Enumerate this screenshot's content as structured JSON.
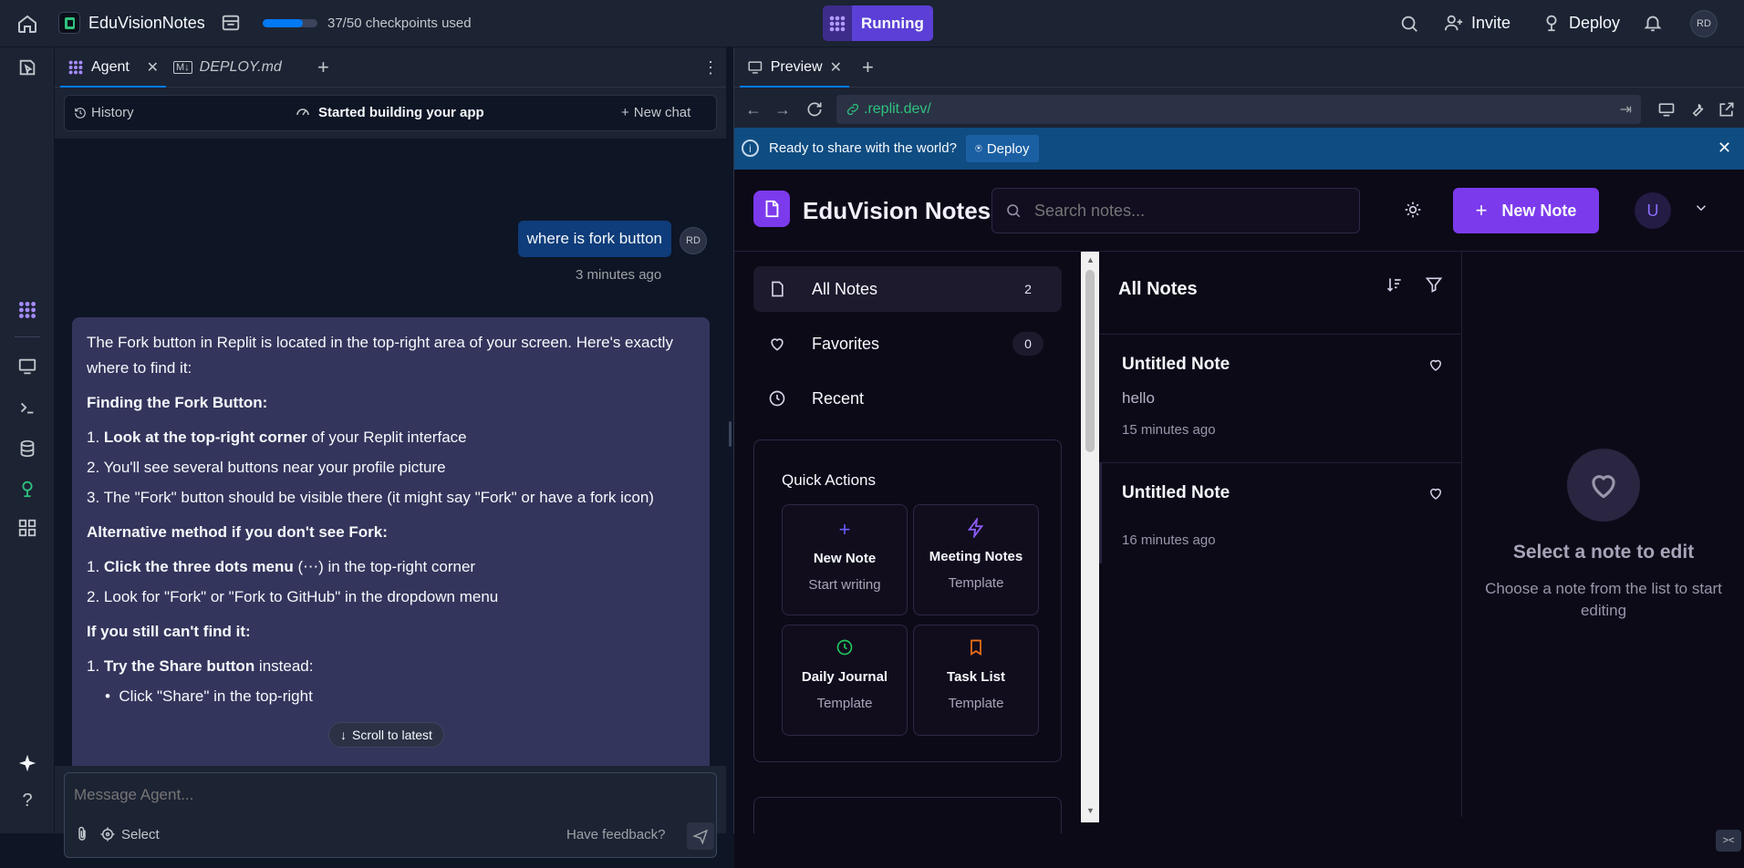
{
  "topbar": {
    "project_name": "EduVisionNotes",
    "checkpoints": "37/50 checkpoints used",
    "checkpoints_progress": 0.74,
    "run_status": "Running",
    "invite_label": "Invite",
    "deploy_label": "Deploy",
    "user_initials": "RD"
  },
  "agent_tabs": {
    "agent_label": "Agent",
    "deploy_file_label": "DEPLOY.md"
  },
  "agent_header": {
    "history_label": "History",
    "status_label": "Started building your app",
    "new_chat_label": "New chat"
  },
  "chat": {
    "user_message": "where is fork button",
    "user_initials": "RD",
    "user_time": "3 minutes ago",
    "response": {
      "intro": "The Fork button in Replit is located in the top-right area of your screen. Here's exactly where to find it:",
      "heading1": "Finding the Fork Button:",
      "step1_bold": "Look at the top-right corner",
      "step1_rest": " of your Replit interface",
      "step2": "You'll see several buttons near your profile picture",
      "step3": "The \"Fork\" button should be visible there (it might say \"Fork\" or have a fork icon)",
      "heading2": "Alternative method if you don't see Fork:",
      "alt1_bold": "Click the three dots menu",
      "alt1_rest": " (⋯) in the top-right corner",
      "alt2": "Look for \"Fork\" or \"Fork to GitHub\" in the dropdown menu",
      "heading3": "If you still can't find it:",
      "still1_bold": "Try the Share button",
      "still1_rest": " instead:",
      "bullet1": "Click \"Share\" in the top-right"
    },
    "scroll_latest_label": "Scroll to latest"
  },
  "composer": {
    "placeholder": "Message Agent...",
    "select_label": "Select",
    "feedback_label": "Have feedback?"
  },
  "preview": {
    "tab_label": "Preview",
    "url": ".replit.dev/",
    "banner_text": "Ready to share with the world?",
    "banner_deploy": "Deploy"
  },
  "app": {
    "title": "EduVision Notes",
    "search_placeholder": "Search notes...",
    "new_note_label": "New Note",
    "avatar_initial": "U",
    "nav": [
      {
        "label": "All Notes",
        "count": "2"
      },
      {
        "label": "Favorites",
        "count": "0"
      },
      {
        "label": "Recent",
        "count": ""
      }
    ],
    "quick_actions_title": "Quick Actions",
    "quick_actions": [
      {
        "title": "New Note",
        "subtitle": "Start writing",
        "icon": "plus-icon",
        "color": "#6a5cff"
      },
      {
        "title": "Meeting Notes",
        "subtitle": "Template",
        "icon": "lightning-icon",
        "color": "#8b5cf6"
      },
      {
        "title": "Daily Journal",
        "subtitle": "Template",
        "icon": "clock-icon",
        "color": "#22c55e"
      },
      {
        "title": "Task List",
        "subtitle": "Template",
        "icon": "bookmark-icon",
        "color": "#f97316"
      }
    ],
    "list_title": "All Notes",
    "notes": [
      {
        "title": "Untitled Note",
        "preview": "hello",
        "time": "15 minutes ago"
      },
      {
        "title": "Untitled Note",
        "preview": "",
        "time": "16 minutes ago"
      }
    ],
    "empty_title": "Select a note to edit",
    "empty_subtitle": "Choose a note from the list to start editing"
  },
  "colors": {
    "accent_purple": "#7c3aed",
    "running_bg": "#5b3fd6",
    "banner_blue": "#0f4c81"
  }
}
